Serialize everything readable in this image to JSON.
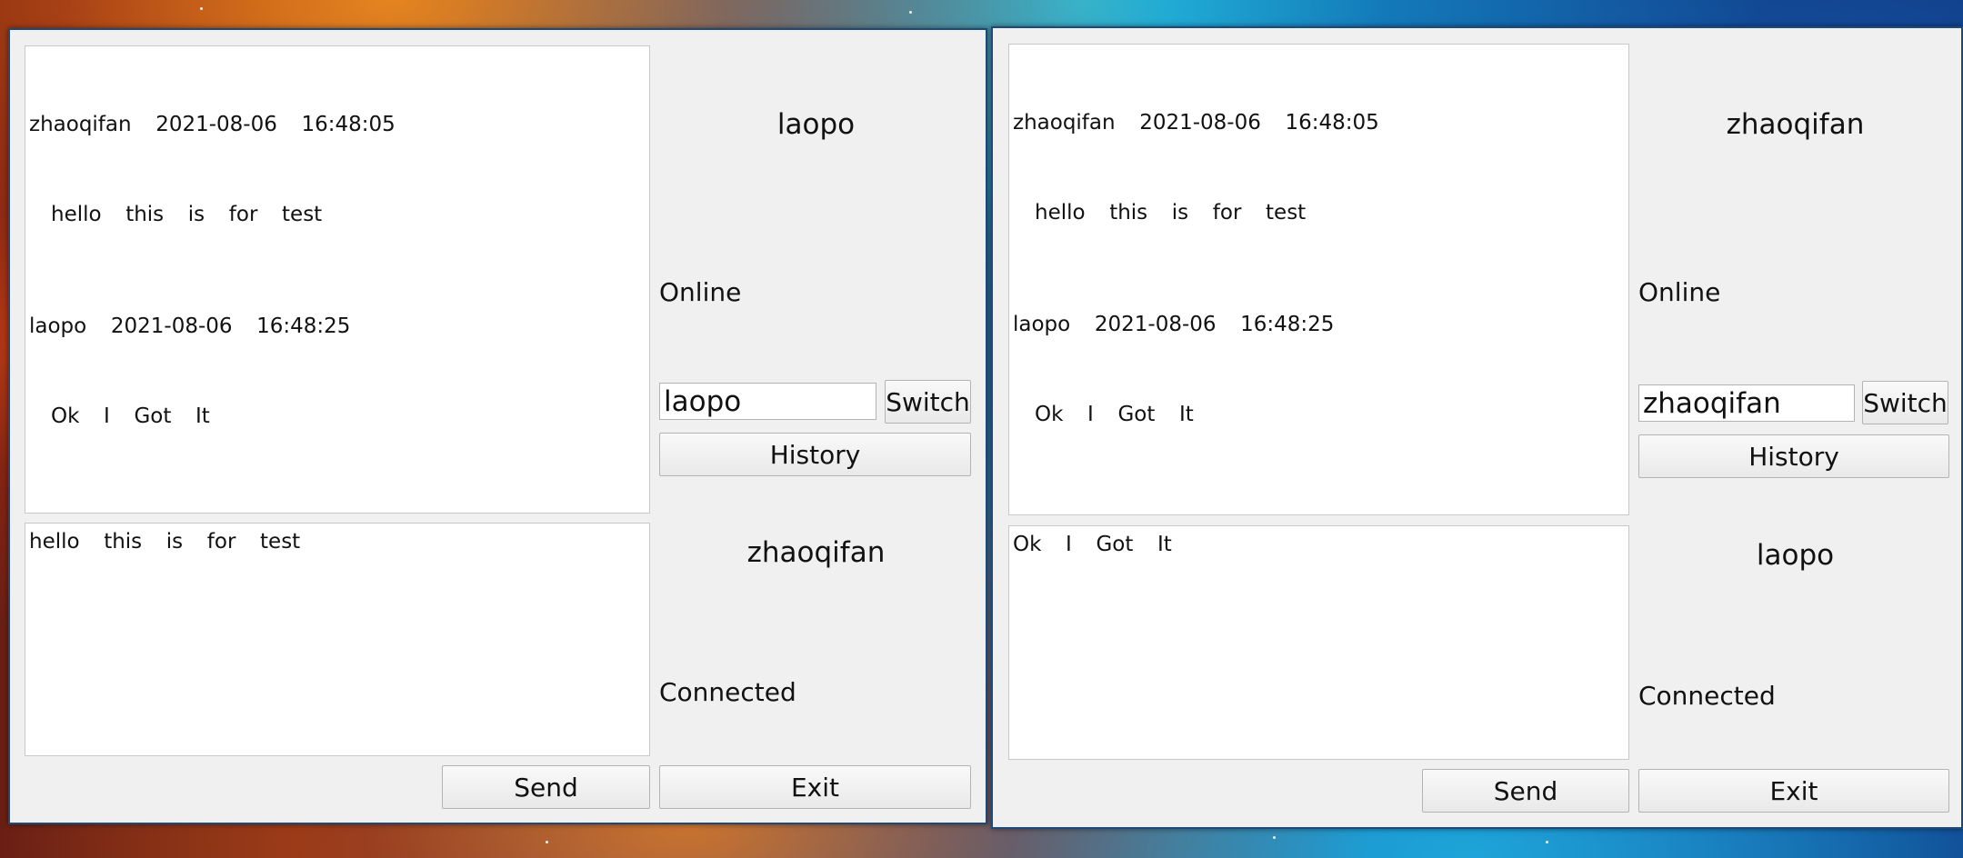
{
  "windows": [
    {
      "chat_log": [
        {
          "sender": "zhaoqifan",
          "time": "2021-08-06  16:48:05",
          "text": "hello  this  is  for  test"
        },
        {
          "sender": "laopo",
          "time": "2021-08-06  16:48:25",
          "text": "Ok  I  Got  It"
        }
      ],
      "message_draft": "hello  this  is  for  test",
      "peer_name": "laopo",
      "peer_status": "Online",
      "switch_input_value": "laopo",
      "switch_label": "Switch",
      "history_label": "History",
      "self_name": "zhaoqifan",
      "connection_status": "Connected",
      "send_label": "Send",
      "exit_label": "Exit"
    },
    {
      "chat_log": [
        {
          "sender": "zhaoqifan",
          "time": "2021-08-06  16:48:05",
          "text": "hello  this  is  for  test"
        },
        {
          "sender": "laopo",
          "time": "2021-08-06  16:48:25",
          "text": "Ok  I  Got  It"
        }
      ],
      "message_draft": "Ok  I  Got  It",
      "peer_name": "zhaoqifan",
      "peer_status": "Online",
      "switch_input_value": "zhaoqifan",
      "switch_label": "Switch",
      "history_label": "History",
      "self_name": "laopo",
      "connection_status": "Connected",
      "send_label": "Send",
      "exit_label": "Exit"
    }
  ],
  "colors": {
    "window_bg": "#f0f0f0",
    "window_border": "#1f4a78",
    "text_area_bg": "#ffffff"
  }
}
